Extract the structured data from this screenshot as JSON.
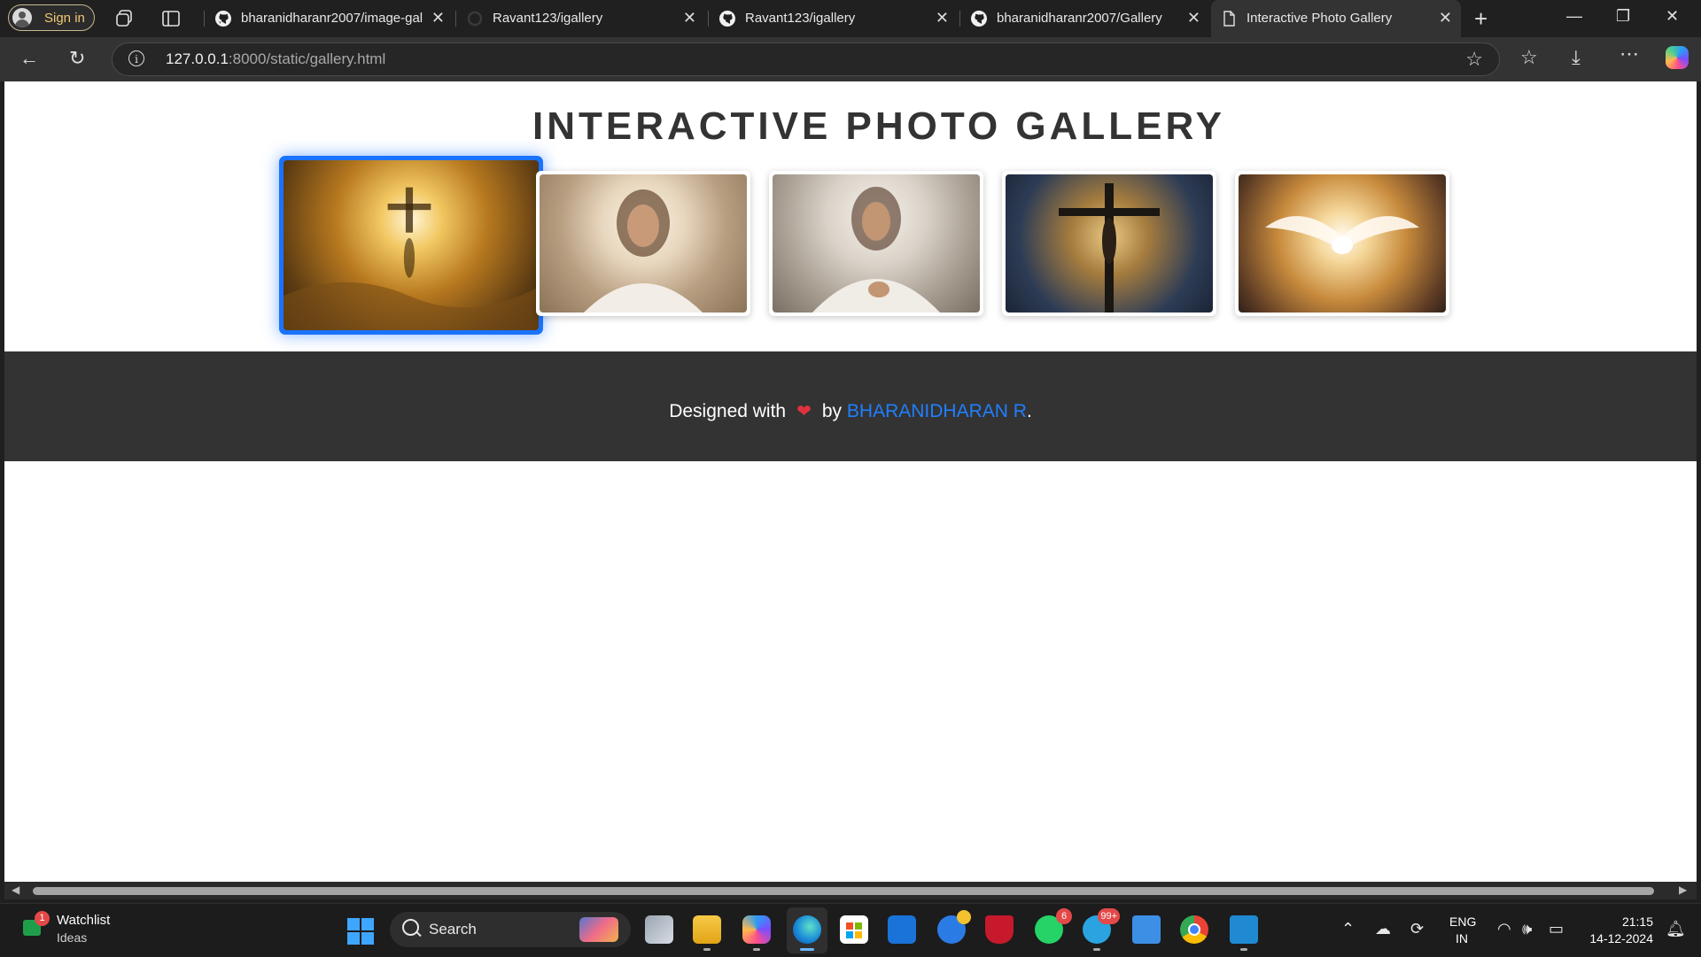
{
  "browser": {
    "sign_in_label": "Sign in",
    "tabs": [
      {
        "title": "bharanidharanr2007/image-gal",
        "icon": "github-icon"
      },
      {
        "title": "Ravant123/igallery",
        "icon": "github-icon-loading"
      },
      {
        "title": "Ravant123/igallery",
        "icon": "github-icon"
      },
      {
        "title": "bharanidharanr2007/Gallery",
        "icon": "github-icon"
      },
      {
        "title": "Interactive Photo Gallery",
        "icon": "page-icon"
      }
    ],
    "address": {
      "host": "127.0.0.1",
      "path": ":8000/static/gallery.html"
    }
  },
  "page": {
    "title": "INTERACTIVE PHOTO GALLERY",
    "gallery": [
      {
        "subject": "cross-in-golden-clouds",
        "selected": true
      },
      {
        "subject": "portrait-glowing-halo",
        "selected": false
      },
      {
        "subject": "portrait-hand-on-heart",
        "selected": false
      },
      {
        "subject": "crucifix-in-clouds",
        "selected": false
      },
      {
        "subject": "white-dove-in-light",
        "selected": false
      }
    ],
    "footer": {
      "prefix": "Designed with",
      "heart": "❤",
      "by": "by",
      "author": "BHARANIDHARAN R",
      "suffix": "."
    }
  },
  "taskbar": {
    "widget": {
      "title": "Watchlist",
      "subtitle": "Ideas",
      "badge": "1"
    },
    "search_label": "Search",
    "badges": {
      "whatsapp": "6",
      "telegram": "99+"
    },
    "language": {
      "line1": "ENG",
      "line2": "IN"
    },
    "clock": {
      "time": "21:15",
      "date": "14-12-2024"
    }
  },
  "colors": {
    "accent": "#1a73ff",
    "footer_bg": "#333333",
    "author_link": "#1f7fff",
    "heart": "#e0323e"
  }
}
